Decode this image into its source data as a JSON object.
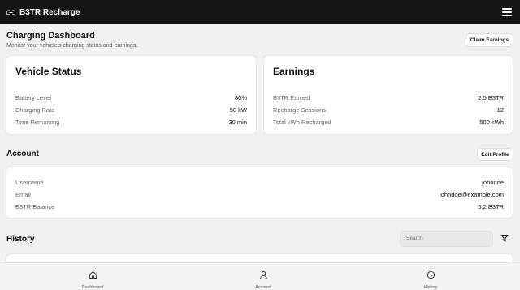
{
  "app": {
    "title": "B3TR Recharge",
    "logo_icon": "link-icon",
    "menu_icon": "hamburger-icon"
  },
  "dashboard": {
    "title": "Charging Dashboard",
    "subtitle": "Monitor your vehicle's charging status and earnings.",
    "claim_label": "Claim Earnings"
  },
  "vehicle": {
    "title": "Vehicle Status",
    "rows": [
      {
        "label": "Battery Level",
        "value": "80%"
      },
      {
        "label": "Charging Rate",
        "value": "50 kW"
      },
      {
        "label": "Time Remaining",
        "value": "30 min"
      }
    ]
  },
  "earnings": {
    "title": "Earnings",
    "rows": [
      {
        "label": "B3TR Earned",
        "value": "2.5 B3TR"
      },
      {
        "label": "Recharge Sessions",
        "value": "12"
      },
      {
        "label": "Total kWh Recharged",
        "value": "500 kWh"
      }
    ]
  },
  "account": {
    "title": "Account",
    "edit_label": "Edit Profile",
    "rows": [
      {
        "label": "Username",
        "value": "johndoe"
      },
      {
        "label": "Email",
        "value": "johndoe@example.com"
      },
      {
        "label": "B3TR Balance",
        "value": "5.2 B3TR"
      }
    ]
  },
  "history": {
    "title": "History",
    "search_placeholder": "Search",
    "filter_icon": "filter-icon"
  },
  "nav": [
    {
      "label": "Dashboard",
      "icon": "home-icon"
    },
    {
      "label": "Account",
      "icon": "user-icon"
    },
    {
      "label": "History",
      "icon": "clock-icon"
    }
  ]
}
